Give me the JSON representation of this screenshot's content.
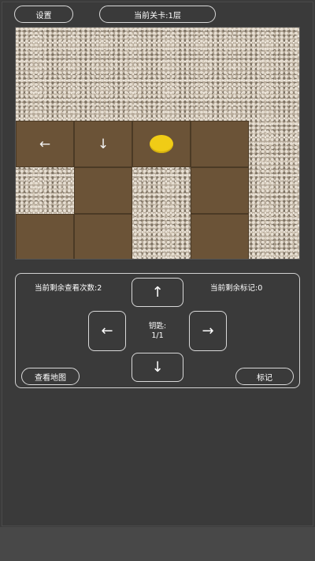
{
  "header": {
    "settings_label": "设置",
    "level_label": "当前关卡:1层"
  },
  "board": {
    "floor_color": "#6b5337",
    "wall_texture": "cobblestone",
    "tiles": [
      {
        "row": 2,
        "col": 0,
        "content": "arrow-left",
        "glyph": "←"
      },
      {
        "row": 2,
        "col": 1,
        "content": "arrow-down",
        "glyph": "↓"
      },
      {
        "row": 2,
        "col": 2,
        "content": "coin",
        "glyph": ""
      },
      {
        "row": 2,
        "col": 3,
        "content": "",
        "glyph": ""
      },
      {
        "row": 3,
        "col": 1,
        "content": "",
        "glyph": ""
      },
      {
        "row": 3,
        "col": 3,
        "content": "",
        "glyph": ""
      },
      {
        "row": 4,
        "col": 0,
        "content": "",
        "glyph": ""
      },
      {
        "row": 4,
        "col": 1,
        "content": "",
        "glyph": ""
      },
      {
        "row": 4,
        "col": 3,
        "content": "",
        "glyph": ""
      }
    ]
  },
  "controls": {
    "views_left": "当前剩余查看次数:2",
    "marks_left": "当前剩余标记:0",
    "up_icon": "↑",
    "down_icon": "↓",
    "left_icon": "←",
    "right_icon": "→",
    "keys_label": "钥匙:",
    "keys_value": "1/1",
    "view_map_label": "查看地图",
    "mark_label": "标记"
  },
  "colors": {
    "background": "#3c3c3c",
    "coin": "#f0cc16",
    "border": "#d8d8d8"
  }
}
